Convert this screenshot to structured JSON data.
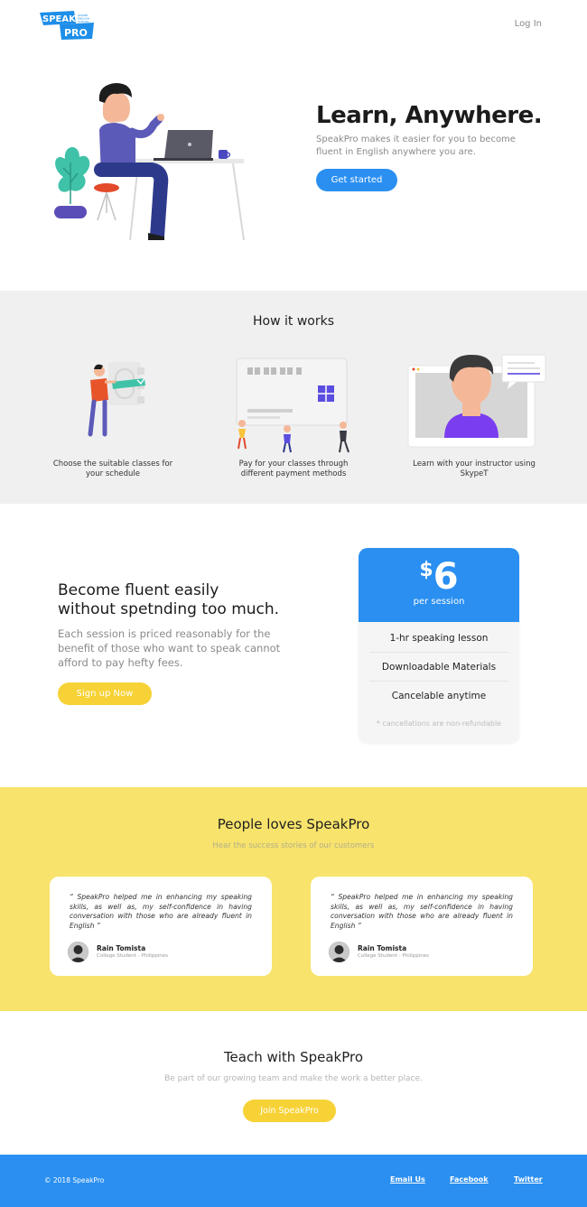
{
  "header": {
    "logo_top": "SPEAK",
    "logo_bottom": "PRO",
    "logo_tag": "ONLINE ENGLISH SCHOOL",
    "login": "Log In"
  },
  "hero": {
    "title": "Learn, Anywhere.",
    "subtitle": "SpeakPro makes it easier for you to become fluent in English anywhere you are.",
    "cta": "Get started"
  },
  "how": {
    "title": "How it works",
    "steps": [
      {
        "caption": "Choose the suitable classes for your schedule"
      },
      {
        "caption": "Pay for your classes through different payment methods"
      },
      {
        "caption": "Learn with your instructor using SkypeT"
      }
    ]
  },
  "pricing": {
    "title_line1": "Become fluent easily",
    "title_line2": "without spetnding too much.",
    "description": "Each session is priced reasonably for the benefit of those who want to speak cannot afford to pay hefty fees.",
    "cta": "Sign up Now",
    "card": {
      "currency": "$",
      "amount": "6",
      "per": "per session",
      "features": [
        "1-hr speaking lesson",
        "Downloadable Materials",
        "Cancelable anytime"
      ],
      "note": "* cancellations are non-refundable"
    }
  },
  "testimonials": {
    "title": "People loves SpeakPro",
    "subtitle": "Hear the success stories of our customers",
    "items": [
      {
        "quote": "“ SpeakPro helped me in enhancing my speaking skills, as well as, my self-confidence in having conversation with those who are already fluent in English ”",
        "name": "Rain Tomista",
        "role": "College Student - Philippines"
      },
      {
        "quote": "“ SpeakPro helped me in enhancing my speaking skills, as well as, my self-confidence in having conversation with those who are already fluent in English ”",
        "name": "Rain Tomista",
        "role": "College Student - Philippines"
      }
    ]
  },
  "teach": {
    "title": "Teach with SpeakPro",
    "subtitle": "Be part of our growing team and make the work a better place.",
    "cta": "Join SpeakPro"
  },
  "footer": {
    "copyright": "© 2018 SpeakPro",
    "links": [
      "Email Us",
      "Facebook",
      "Twitter"
    ]
  },
  "colors": {
    "primary_blue": "#2a8ff1",
    "accent_yellow": "#f7d236",
    "testimonial_bg": "#f8e36c",
    "section_gray": "#f0f0f0"
  }
}
